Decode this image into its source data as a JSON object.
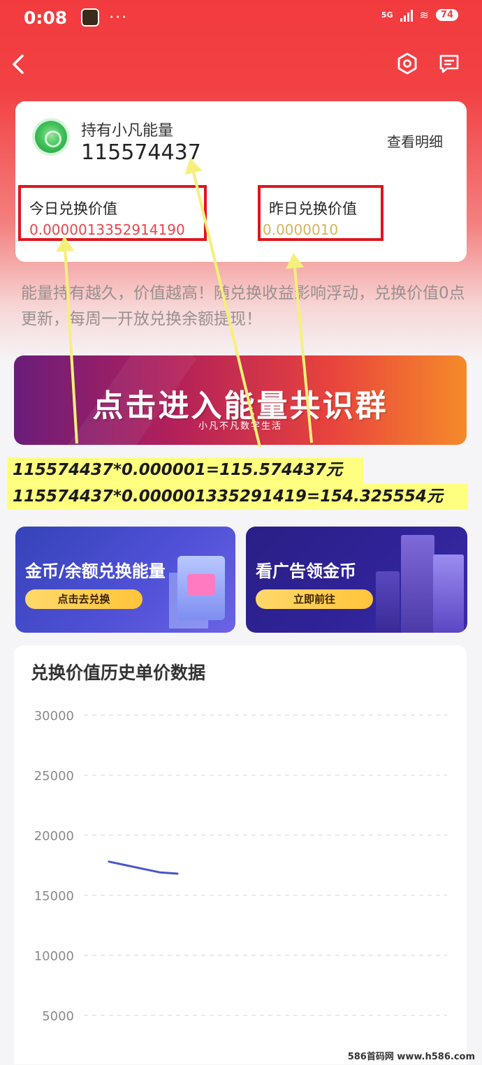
{
  "status_bar": {
    "time": "0:08",
    "dots": "···",
    "network": "5G",
    "battery": "74"
  },
  "header": {
    "back_icon": "chevron-left-icon",
    "settings_icon": "hexagon-settings-icon",
    "message_icon": "message-icon"
  },
  "energy_card": {
    "label": "持有小凡能量",
    "value": "115574437",
    "detail_link": "查看明细",
    "today_label": "今日兑换价值",
    "today_value": "0.0000013352914190",
    "yesterday_label": "昨日兑换价值",
    "yesterday_value": "0.0000010"
  },
  "notice": "能量持有越久，价值越高！随兑换收益影响浮动，兑换价值0点更新，每周一开放兑换余额提现！",
  "group_banner": {
    "title": "点击进入能量共识群",
    "subtitle": "小凡不凡数字生活"
  },
  "calculation": {
    "line1": "115574437*0.000001=115.574437元",
    "line2": "115574437*0.000001335291419=154.325554元"
  },
  "promos": [
    {
      "title": "金币/余额兑换能量",
      "button": "点击去兑换"
    },
    {
      "title": "看广告领金币",
      "button": "立即前往"
    }
  ],
  "chart_data": {
    "type": "line",
    "title": "兑换价值历史单价数据",
    "xlabel": "",
    "ylabel": "",
    "ylim": [
      0,
      30000
    ],
    "yticks": [
      30000,
      25000,
      20000,
      15000,
      10000,
      5000
    ],
    "grid": true,
    "series": [
      {
        "values": [
          17800,
          17500,
          17200,
          16900,
          16800
        ],
        "color": "#4a55c8"
      }
    ]
  },
  "annotation": {
    "box_color": "#e0151d",
    "arrow_color": "#f5f07a"
  },
  "watermark": "586首码网 www.h586.com"
}
